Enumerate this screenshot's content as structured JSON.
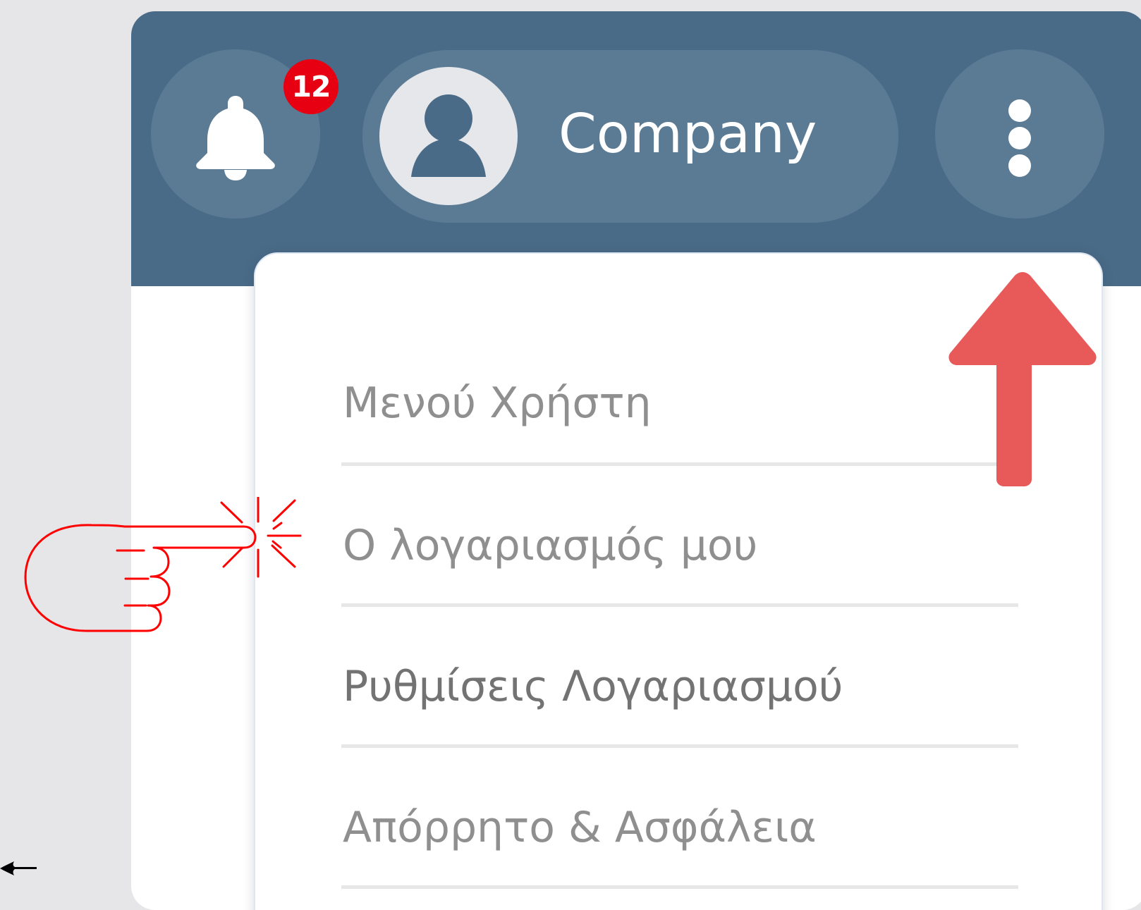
{
  "header": {
    "notifications": {
      "icon": "bell-icon",
      "count": "12",
      "badge_color": "#e60012"
    },
    "profile": {
      "avatar_icon": "user-avatar-icon",
      "name": "Company"
    },
    "more_icon": "vertical-dots-icon",
    "background_color": "#4a6b87"
  },
  "menu": {
    "items": [
      {
        "label": "Μενού Χρήστη"
      },
      {
        "label": "Ο λογαριασμός μου"
      },
      {
        "label": "Ρυθμίσεις Λογαριασμού"
      },
      {
        "label": "Απόρρητο & Ασφάλεια"
      }
    ]
  },
  "annotations": {
    "arrow_icon": "arrow-up-icon",
    "arrow_color": "#e85a5a",
    "hand_icon": "pointing-hand-icon",
    "hand_color": "#ff0000"
  }
}
